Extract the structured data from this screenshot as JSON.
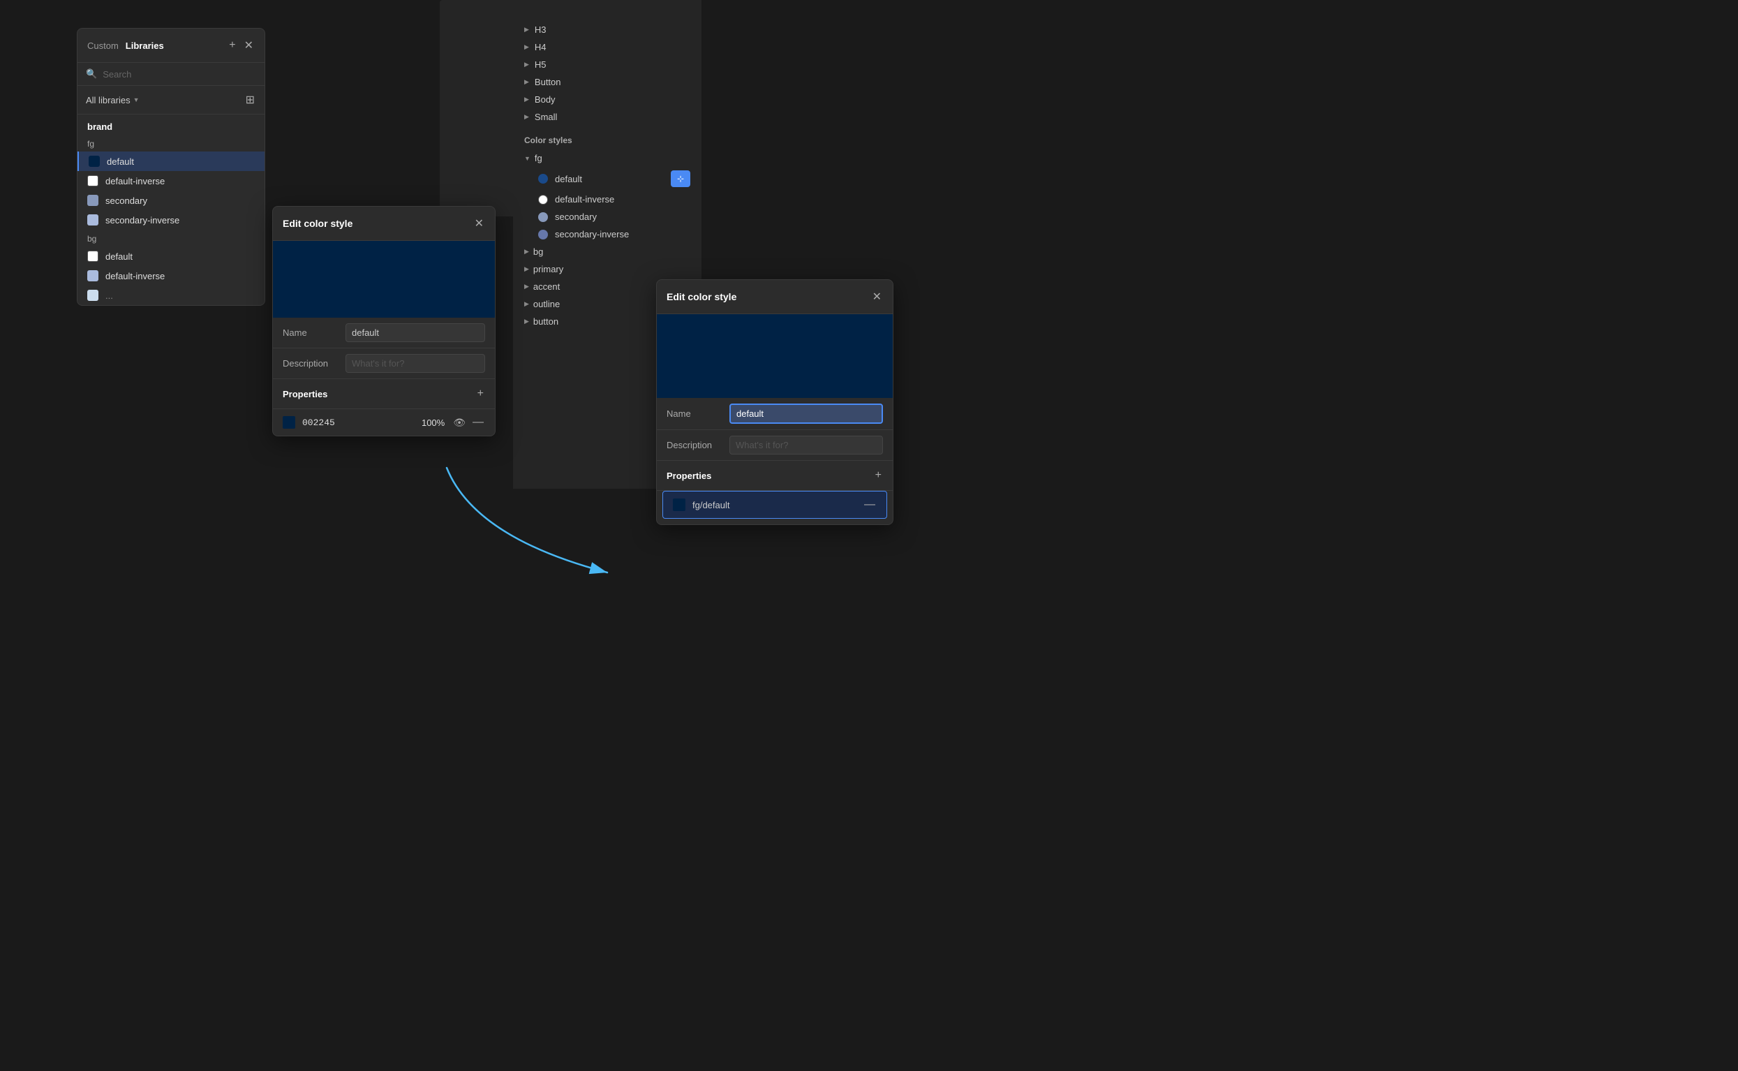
{
  "librariesPanel": {
    "tabs": [
      {
        "label": "Custom",
        "active": false
      },
      {
        "label": "Libraries",
        "active": true
      }
    ],
    "searchPlaceholder": "Search",
    "filterLabel": "All libraries",
    "sections": [
      {
        "label": "brand",
        "subsections": [
          {
            "label": "fg",
            "items": [
              {
                "name": "default",
                "color": "#002245",
                "highlighted": true
              },
              {
                "name": "default-inverse",
                "color": "#ffffff"
              },
              {
                "name": "secondary",
                "color": "#8899bb"
              },
              {
                "name": "secondary-inverse",
                "color": "#aabbdd"
              }
            ]
          },
          {
            "label": "bg",
            "items": [
              {
                "name": "default",
                "color": "#ffffff"
              },
              {
                "name": "default-inverse",
                "color": "#aabbdd"
              }
            ]
          }
        ]
      }
    ]
  },
  "colorStylesPanel": {
    "title": "Color styles",
    "typographyItems": [
      {
        "label": "H3"
      },
      {
        "label": "H4"
      },
      {
        "label": "H5"
      },
      {
        "label": "Button"
      },
      {
        "label": "Body"
      },
      {
        "label": "Small"
      }
    ],
    "groups": [
      {
        "label": "fg",
        "expanded": true,
        "items": [
          {
            "name": "default",
            "color": "#1a4a8a",
            "hasEditBtn": true
          },
          {
            "name": "default-inverse",
            "color": "#ffffff"
          },
          {
            "name": "secondary",
            "color": "#8899bb"
          },
          {
            "name": "secondary-inverse",
            "color": "#6677aa"
          }
        ]
      },
      {
        "label": "bg",
        "expanded": false,
        "items": []
      },
      {
        "label": "primary",
        "expanded": false,
        "items": []
      },
      {
        "label": "accent",
        "expanded": false,
        "items": []
      },
      {
        "label": "outline",
        "expanded": false,
        "items": []
      },
      {
        "label": "button",
        "expanded": false,
        "items": []
      }
    ]
  },
  "editDialog1": {
    "title": "Edit color style",
    "colorPreview": "#002245",
    "nameLabel": "Name",
    "nameValue": "default",
    "descriptionLabel": "Description",
    "descriptionPlaceholder": "What's it for?",
    "propertiesLabel": "Properties",
    "property": {
      "colorHex": "002245",
      "opacity": "100%",
      "color": "#002245"
    }
  },
  "editDialog2": {
    "title": "Edit color style",
    "colorPreview": "#002245",
    "nameLabel": "Name",
    "nameValue": "default",
    "descriptionLabel": "Description",
    "descriptionPlaceholder": "What's it for?",
    "propertiesLabel": "Properties",
    "property": {
      "label": "fg/default",
      "color": "#002245"
    }
  },
  "icons": {
    "search": "🔍",
    "close": "✕",
    "add": "+",
    "grid": "⊞",
    "chevronRight": "▶",
    "chevronDown": "▼",
    "eye": "👁",
    "minus": "—",
    "edit": "⚙",
    "sliders": "⊹"
  }
}
